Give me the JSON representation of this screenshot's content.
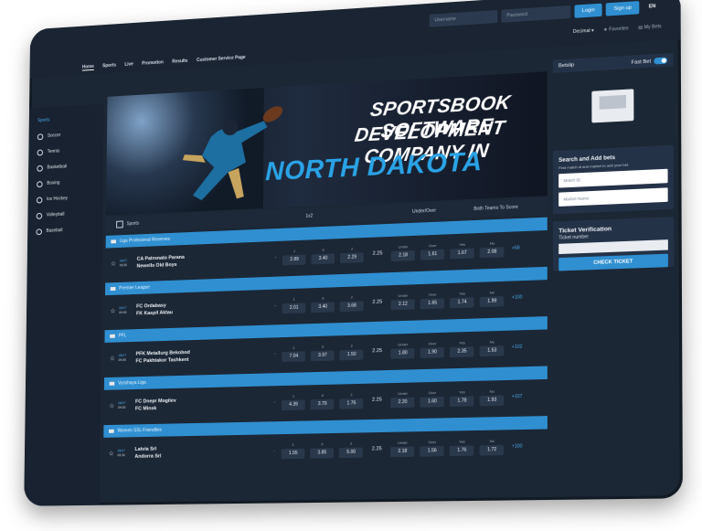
{
  "header": {
    "nav": [
      "Home",
      "Sports",
      "Live",
      "Promotion",
      "Results",
      "Customer Service Page"
    ],
    "username_placeholder": "Username",
    "password_placeholder": "Password",
    "login_label": "Login",
    "signup_label": "Sign up",
    "lang": "EN",
    "odds_format": "Decimal",
    "favorites_label": "Favorites",
    "my_bets_label": "My Bets"
  },
  "sidebar": {
    "title": "Sports",
    "items": [
      "Soccer",
      "Tennis",
      "Basketball",
      "Boxing",
      "Ice Hockey",
      "Volleyball",
      "Baseball"
    ]
  },
  "banner": {
    "line1": "SPORTSBOOK SOFTWARE",
    "line2": "DEVELOPMENT COMPANY IN",
    "line3": "NORTH DAKOTA"
  },
  "table": {
    "sports_label": "Sports",
    "col_1x2": "1x2",
    "col_uo": "Under/Over",
    "col_bts": "Both Teams To Score",
    "labels": [
      "1",
      "X",
      "2",
      "Under",
      "Over",
      "Yes",
      "No"
    ],
    "groups": [
      {
        "league": "Liga Profesional Reserves",
        "date": "08/07",
        "time": "09:30",
        "home": "CA Patronato Parana",
        "away": "Newells Old Boys",
        "dash": "-",
        "o1": "2.89",
        "ox": "3.40",
        "o2": "2.29",
        "total": "2.25",
        "under": "2.18",
        "over": "1.61",
        "yes": "1.67",
        "no": "2.08",
        "more": "+58"
      },
      {
        "league": "Premier League",
        "date": "08/07",
        "time": "09:30",
        "home": "FC Ordabasy",
        "away": "FK Kaspil Aktau",
        "dash": "-",
        "o1": "2.01",
        "ox": "3.40",
        "o2": "3.68",
        "total": "2.25",
        "under": "2.12",
        "over": "1.65",
        "yes": "1.74",
        "no": "1.99",
        "more": "+100"
      },
      {
        "league": "PFL",
        "date": "08/07",
        "time": "09:30",
        "home": "PFK Metallurg Bekobod",
        "away": "FC Pakhtakor Tashkent",
        "dash": "-",
        "o1": "7.04",
        "ox": "3.97",
        "o2": "1.50",
        "total": "2.25",
        "under": "1.80",
        "over": "1.90",
        "yes": "2.35",
        "no": "1.53",
        "more": "+102"
      },
      {
        "league": "Vysshaya Liga",
        "date": "08/07",
        "time": "09:30",
        "home": "FC Dnepr Mogilev",
        "away": "FC Minsk",
        "dash": "-",
        "o1": "4.39",
        "ox": "3.79",
        "o2": "1.76",
        "total": "2.25",
        "under": "2.20",
        "over": "1.60",
        "yes": "1.78",
        "no": "1.93",
        "more": "+107"
      },
      {
        "league": "Women SSL Friendlies",
        "date": "08/07",
        "time": "09:30",
        "home": "Latvia Srl",
        "away": "Andorra Srl",
        "dash": "-",
        "o1": "1.55",
        "ox": "3.85",
        "o2": "5.00",
        "total": "2.25",
        "under": "2.18",
        "over": "1.56",
        "yes": "1.76",
        "no": "1.72",
        "more": "+100"
      }
    ]
  },
  "betslip": {
    "title": "Betslip",
    "fast_bet": "Fast Bet"
  },
  "search_bets": {
    "title": "Search and Add bets",
    "subtitle": "Find match id and market to add your bet.",
    "match_placeholder": "Match ID",
    "market_placeholder": "Market Name"
  },
  "ticket": {
    "title": "Ticket Verification",
    "label": "Ticket number",
    "button": "CHECK TICKET"
  }
}
